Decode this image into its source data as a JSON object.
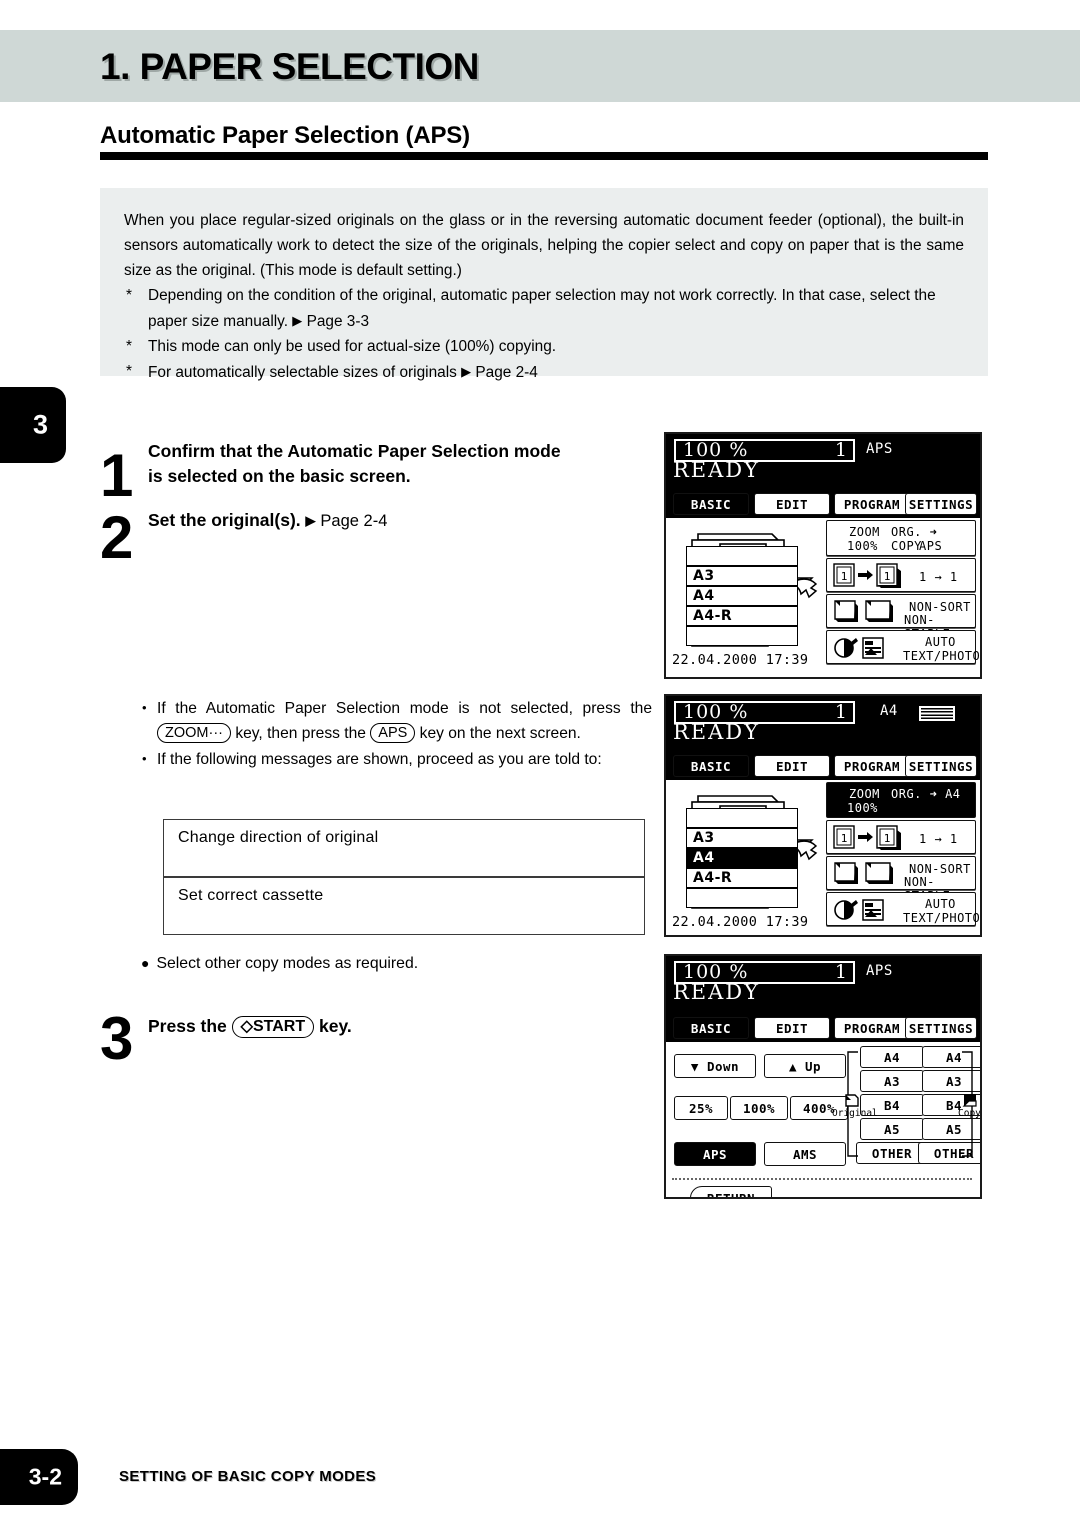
{
  "chapter_tab": "3",
  "banner": {
    "title": "1. PAPER SELECTION"
  },
  "section": {
    "title": "Automatic Paper Selection (APS)"
  },
  "intro": {
    "paragraph": "When you place regular-sized originals on the glass or in the reversing automatic document feeder (optional), the built-in sensors automatically work to detect the size of the originals, helping the copier select and copy on paper that is the same size as the original. (This mode is default setting.)",
    "notes": [
      "Depending on the condition of the original, automatic paper selection may not work correctly. In that case, select the paper size manually.",
      "This mode can only be used for actual-size (100%) copying.",
      "For automatically selectable sizes of originals"
    ],
    "note_refs": [
      "Page 3-3",
      "",
      "Page 2-4"
    ],
    "star": "*",
    "triangle": "▶"
  },
  "steps": [
    {
      "num": "1",
      "line1": "Confirm that the Automatic Paper Selection mode",
      "line2": "is selected on the basic screen."
    },
    {
      "num": "2",
      "text": "Set the original(s).",
      "ref": "Page 2-4"
    },
    {
      "num": "3",
      "pre": "Press the",
      "key": "◇START",
      "post": "key."
    }
  ],
  "bullets": [
    {
      "p1": "If the Automatic Paper Selection mode is not selected, press",
      "p2": "the",
      "key1": "ZOOM···",
      "p3": "key, then press the",
      "key2": "APS",
      "p4": "key on the next screen."
    },
    {
      "p1": "If the following messages are shown, proceed as you are told to:"
    }
  ],
  "messages": [
    "Change direction of original",
    "Set correct cassette"
  ],
  "select_note": "Select other copy modes as required.",
  "lcd_common": {
    "ratio": "100",
    "percent": "%",
    "count": "1",
    "ready": "READY",
    "tabs": [
      "BASIC",
      "EDIT",
      "PROGRAM",
      "SETTINGS"
    ],
    "active_tab": "BASIC",
    "cassettes": [
      "",
      "A3",
      "A4",
      "A4-R",
      ""
    ],
    "datetime": "22.04.2000 17:39",
    "zoom_label": "ZOOM",
    "zoom_value": "100%",
    "orgcopy_label": "ORG. ➜ COPY",
    "dup_label": "1 → 1",
    "finish_label_1": "NON-SORT",
    "finish_label_2": "NON-STAPLE",
    "exposure_label_1": "AUTO",
    "exposure_label_2": "TEXT/PHOTO"
  },
  "lcd1": {
    "header_mode": "APS",
    "selected_cassette": "",
    "orgcopy_target": "APS",
    "orgcopy_label": "ORG. ➜ COPY",
    "zoom_inverted": false
  },
  "lcd2": {
    "header_mode": "A4",
    "header_icon": "paper-stack-icon",
    "selected_cassette": "A4",
    "orgcopy_target": "",
    "orgcopy_label": "ORG. ➜  A4",
    "zoom_inverted": true
  },
  "lcd3": {
    "header_mode": "APS",
    "buttons": {
      "down": "▼ Down",
      "up": "▲ Up",
      "p25": "25%",
      "p100": "100%",
      "p400": "400%",
      "aps": "APS",
      "ams": "AMS",
      "return": "RETURN"
    },
    "original_label": "Original",
    "copy_label": "Copy",
    "original_sizes": [
      "A4",
      "A3",
      "B4",
      "A5",
      "OTHER"
    ],
    "copy_sizes": [
      "A4",
      "A3",
      "B4",
      "A5",
      "OTHER"
    ],
    "active_button": "APS"
  },
  "footer": {
    "page": "3-2",
    "title": "SETTING OF BASIC COPY MODES"
  }
}
